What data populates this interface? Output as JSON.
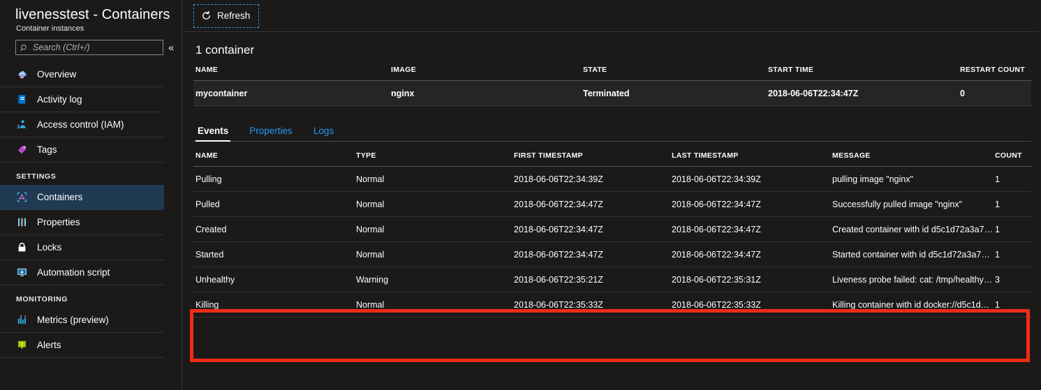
{
  "blade": {
    "title": "livenesstest - Containers",
    "subtitle": "Container instances"
  },
  "search": {
    "placeholder": "Search (Ctrl+/)",
    "value": "",
    "collapse_label": "«"
  },
  "sidebar": {
    "items": [
      {
        "label": "Overview",
        "icon": "cloud-overview-icon",
        "selected": false
      },
      {
        "label": "Activity log",
        "icon": "activity-log-icon",
        "selected": false
      },
      {
        "label": "Access control (IAM)",
        "icon": "access-control-icon",
        "selected": false
      },
      {
        "label": "Tags",
        "icon": "tag-icon",
        "selected": false
      }
    ],
    "settings_label": "SETTINGS",
    "settings_items": [
      {
        "label": "Containers",
        "icon": "containers-icon",
        "selected": true
      },
      {
        "label": "Properties",
        "icon": "properties-icon",
        "selected": false
      },
      {
        "label": "Locks",
        "icon": "lock-icon",
        "selected": false
      },
      {
        "label": "Automation script",
        "icon": "automation-script-icon",
        "selected": false
      }
    ],
    "monitoring_label": "MONITORING",
    "monitoring_items": [
      {
        "label": "Metrics (preview)",
        "icon": "metrics-icon",
        "selected": false
      },
      {
        "label": "Alerts",
        "icon": "alerts-icon",
        "selected": false
      }
    ]
  },
  "toolbar": {
    "refresh_label": "Refresh",
    "refresh_icon": "refresh-icon"
  },
  "containers_section": {
    "title": "1 container",
    "columns": [
      "NAME",
      "IMAGE",
      "STATE",
      "START TIME",
      "RESTART COUNT"
    ],
    "rows": [
      {
        "name": "mycontainer",
        "image": "nginx",
        "state": "Terminated",
        "start_time": "2018-06-06T22:34:47Z",
        "restart_count": "0"
      }
    ]
  },
  "tabs": [
    {
      "label": "Events",
      "active": true
    },
    {
      "label": "Properties",
      "active": false
    },
    {
      "label": "Logs",
      "active": false
    }
  ],
  "events_table": {
    "columns": [
      "NAME",
      "TYPE",
      "FIRST TIMESTAMP",
      "LAST TIMESTAMP",
      "MESSAGE",
      "COUNT"
    ],
    "rows": [
      {
        "name": "Pulling",
        "type": "Normal",
        "first_timestamp": "2018-06-06T22:34:39Z",
        "last_timestamp": "2018-06-06T22:34:39Z",
        "message": "pulling image \"nginx\"",
        "count": "1",
        "highlighted": false
      },
      {
        "name": "Pulled",
        "type": "Normal",
        "first_timestamp": "2018-06-06T22:34:47Z",
        "last_timestamp": "2018-06-06T22:34:47Z",
        "message": "Successfully pulled image \"nginx\"",
        "count": "1",
        "highlighted": false
      },
      {
        "name": "Created",
        "type": "Normal",
        "first_timestamp": "2018-06-06T22:34:47Z",
        "last_timestamp": "2018-06-06T22:34:47Z",
        "message": "Created container with id d5c1d72a3a7…",
        "count": "1",
        "highlighted": false
      },
      {
        "name": "Started",
        "type": "Normal",
        "first_timestamp": "2018-06-06T22:34:47Z",
        "last_timestamp": "2018-06-06T22:34:47Z",
        "message": "Started container with id d5c1d72a3a78…",
        "count": "1",
        "highlighted": false
      },
      {
        "name": "Unhealthy",
        "type": "Warning",
        "first_timestamp": "2018-06-06T22:35:21Z",
        "last_timestamp": "2018-06-06T22:35:31Z",
        "message": "Liveness probe failed: cat: /tmp/healthy:…",
        "count": "3",
        "highlighted": true
      },
      {
        "name": "Killing",
        "type": "Normal",
        "first_timestamp": "2018-06-06T22:35:33Z",
        "last_timestamp": "2018-06-06T22:35:33Z",
        "message": "Killing container with id docker://d5c1d…",
        "count": "1",
        "highlighted": true
      }
    ]
  },
  "colors": {
    "page_background": "#1b1a19",
    "selected_nav": "#1f3a52",
    "link_blue": "#2899f5",
    "highlight_red": "#f02b17",
    "row_background": "#262525"
  }
}
